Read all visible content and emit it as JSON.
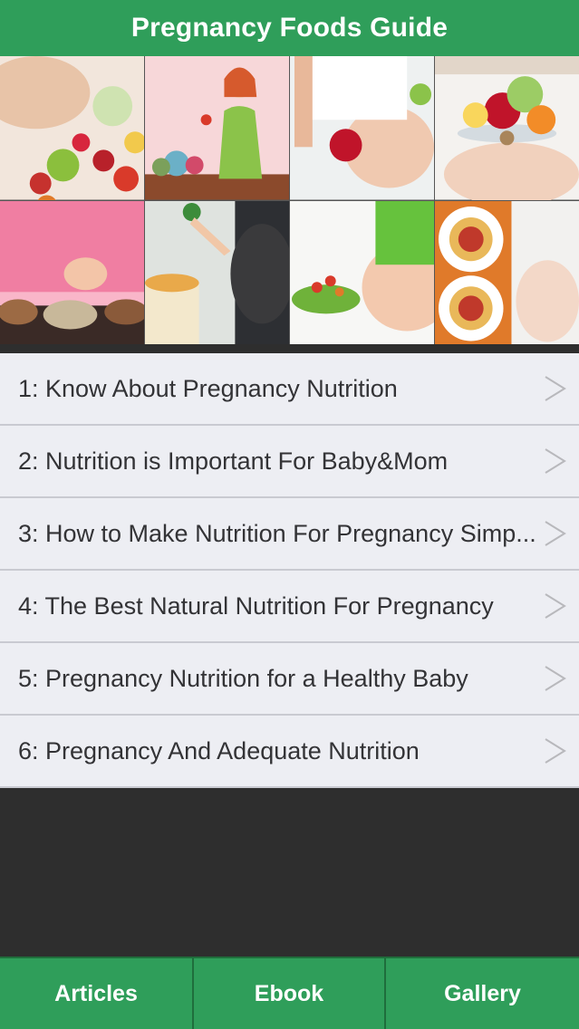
{
  "header": {
    "title": "Pregnancy Foods Guide"
  },
  "gallery": {
    "images": [
      "pregnant-belly-with-vegetables",
      "cartoon-pregnant-woman-cooking",
      "pregnant-woman-holding-apple",
      "pregnant-woman-with-fruit-bowl",
      "pregnant-woman-with-nuts",
      "pregnant-woman-holding-broccoli",
      "pregnant-belly-with-salad",
      "spaghetti-plates"
    ]
  },
  "articles": {
    "items": [
      {
        "label": "1: Know About Pregnancy Nutrition"
      },
      {
        "label": "2: Nutrition is Important For Baby&Mom"
      },
      {
        "label": "3: How to Make Nutrition For Pregnancy Simp..."
      },
      {
        "label": "4: The Best Natural Nutrition For Pregnancy"
      },
      {
        "label": "5: Pregnancy Nutrition for a Healthy Baby"
      },
      {
        "label": "6: Pregnancy And Adequate Nutrition"
      }
    ],
    "chevron_icon": "chevron-right-icon"
  },
  "tabbar": {
    "tabs": [
      {
        "label": "Articles"
      },
      {
        "label": "Ebook"
      },
      {
        "label": "Gallery"
      }
    ]
  },
  "colors": {
    "brand_green": "#2f9e5a",
    "list_background": "#edeef3",
    "page_background": "#2e2e2e"
  }
}
